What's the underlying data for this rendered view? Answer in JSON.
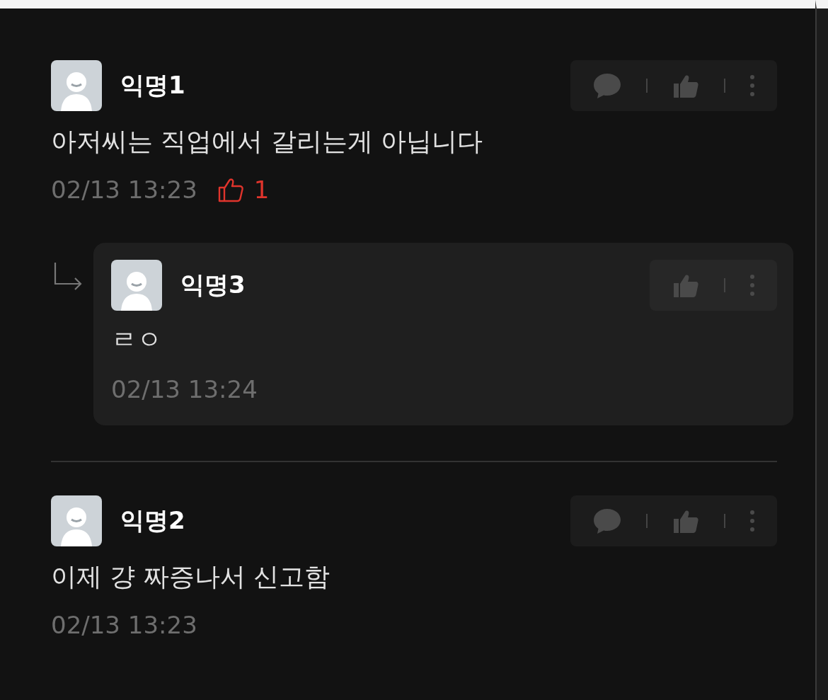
{
  "comments": [
    {
      "author": "익명1",
      "body": "아저씨는 직업에서 갈리는게 아닙니다",
      "time": "02/13 13:23",
      "likes": "1",
      "actions": [
        {
          "kind": "comment"
        },
        {
          "kind": "like"
        },
        {
          "kind": "more"
        }
      ],
      "replies": [
        {
          "author": "익명3",
          "body": "ㄹㅇ",
          "time": "02/13 13:24",
          "actions": [
            {
              "kind": "like"
            },
            {
              "kind": "more"
            }
          ]
        }
      ]
    },
    {
      "author": "익명2",
      "body": "이제 걍 짜증나서 신고함",
      "time": "02/13 13:23",
      "actions": [
        {
          "kind": "comment"
        },
        {
          "kind": "like"
        },
        {
          "kind": "more"
        }
      ]
    }
  ]
}
